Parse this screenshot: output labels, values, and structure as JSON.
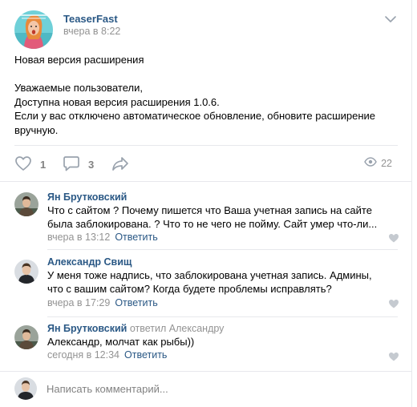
{
  "post": {
    "author": "TeaserFast",
    "time": "вчера в 8:22",
    "avatar_icon": "community-avatar-icon",
    "lines": [
      "Новая версия расширения",
      "",
      "Уважаемые пользователи,",
      "Доступна новая версия расширения 1.0.6.",
      "Если у вас отключено автоматическое обновление, обновите расширение",
      "вручную."
    ]
  },
  "actions": {
    "likes": "1",
    "comments": "3",
    "views": "22",
    "icons": [
      "heart-icon",
      "comment-icon",
      "share-icon",
      "eye-icon"
    ]
  },
  "comments": [
    {
      "author": "Ян Брутковский",
      "reply_to": "",
      "text": "Что с сайтом ? Почему пишется что Ваша учетная запись на сайте была заблокирована. ? Что то не чего не пойму. Сайт умер что-ли...",
      "time": "вчера в 13:12",
      "reply_label": "Ответить"
    },
    {
      "author": "Александр Свищ",
      "reply_to": "",
      "text": "У меня тоже надпись, что заблокирована учетная запись. Админы, что с вашим сайтом? Когда будете проблемы исправлять?",
      "time": "вчера в 17:29",
      "reply_label": "Ответить"
    },
    {
      "author": "Ян Брутковский",
      "reply_to": "ответил Александру",
      "text": "Александр, молчат как рыбы))",
      "time": "сегодня в 12:34",
      "reply_label": "Ответить"
    }
  ],
  "composer": {
    "placeholder": "Написать комментарий..."
  },
  "colors": {
    "link": "#2a5885",
    "muted": "#939393",
    "icon": "#99a2ad",
    "divider": "#e7e8ec"
  }
}
